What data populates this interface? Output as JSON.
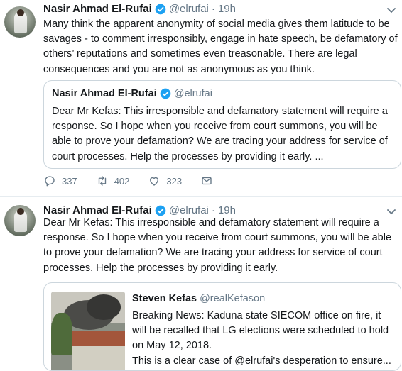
{
  "tweets": [
    {
      "author": {
        "name": "Nasir Ahmad El-Rufai",
        "handle": "@elrufai",
        "time": "19h",
        "separator": "·"
      },
      "text": "Many think the apparent anonymity of social media gives them latitude to be savages - to comment irresponsibly, engage in hate speech, be defamatory  of others’ reputations and sometimes even treasonable. There are legal consequences and you are not as anonymous as you think.",
      "quote": {
        "name": "Nasir Ahmad El-Rufai",
        "handle": "@elrufai",
        "text": "Dear Mr Kefas: This irresponsible and defamatory statement will require a response. So I hope when you receive from court summons, you will be able to prove your defamation? We are tracing your address for service of court processes. Help the processes by providing it early. ..."
      },
      "actions": {
        "replies": "337",
        "retweets": "402",
        "likes": "323"
      }
    },
    {
      "author": {
        "name": "Nasir Ahmad El-Rufai",
        "handle": "@elrufai",
        "time": "19h",
        "separator": "·"
      },
      "text": "Dear Mr Kefas: This irresponsible and defamatory statement will require a response. So I hope when you receive from court summons, you will be able to prove your defamation? We are tracing your address for service of court processes. Help the processes by providing it early.",
      "quote": {
        "name": "Steven Kefas",
        "handle": "@realKefason",
        "text": "Breaking News: Kaduna state SIECOM office on fire, it will be recalled that LG elections were scheduled to hold on May 12, 2018.\nThis is a clear case of @elrufai's desperation to ensure..."
      }
    }
  ],
  "colors": {
    "verified": "#1da1f2",
    "muted": "#657786",
    "border": "#e6ecf0"
  },
  "icons": [
    "verified-badge-icon",
    "chevron-down-icon",
    "reply-icon",
    "retweet-icon",
    "like-icon",
    "direct-message-icon"
  ]
}
